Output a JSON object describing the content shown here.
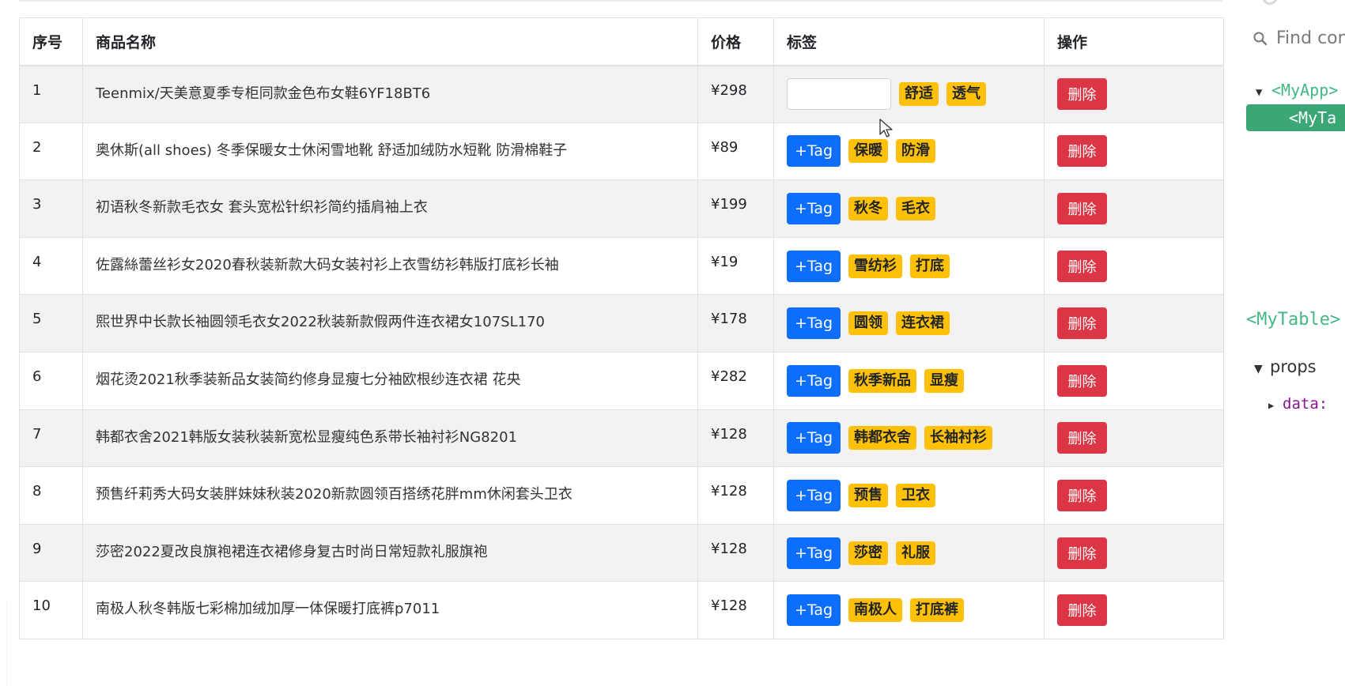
{
  "table": {
    "headers": {
      "index": "序号",
      "name": "商品名称",
      "price": "价格",
      "tags": "标签",
      "actions": "操作"
    },
    "add_tag_label": "+Tag",
    "delete_label": "删除",
    "rows": [
      {
        "id": "1",
        "name": "Teenmix/天美意夏季专柜同款金色布女鞋6YF18BT6",
        "price": "¥298",
        "tags": [
          "舒适",
          "透气"
        ],
        "input_visible": true
      },
      {
        "id": "2",
        "name": "奥休斯(all shoes) 冬季保暖女士休闲雪地靴 舒适加绒防水短靴 防滑棉鞋子",
        "price": "¥89",
        "tags": [
          "保暖",
          "防滑"
        ]
      },
      {
        "id": "3",
        "name": "初语秋冬新款毛衣女 套头宽松针织衫简约插肩袖上衣",
        "price": "¥199",
        "tags": [
          "秋冬",
          "毛衣"
        ]
      },
      {
        "id": "4",
        "name": "佐露絲蕾丝衫女2020春秋装新款大码女装衬衫上衣雪纺衫韩版打底衫长袖",
        "price": "¥19",
        "tags": [
          "雪纺衫",
          "打底"
        ]
      },
      {
        "id": "5",
        "name": "熙世界中长款长袖圆领毛衣女2022秋装新款假两件连衣裙女107SL170",
        "price": "¥178",
        "tags": [
          "圆领",
          "连衣裙"
        ]
      },
      {
        "id": "6",
        "name": "烟花烫2021秋季装新品女装简约修身显瘦七分袖欧根纱连衣裙 花央",
        "price": "¥282",
        "tags": [
          "秋季新品",
          "显瘦"
        ]
      },
      {
        "id": "7",
        "name": "韩都衣舍2021韩版女装秋装新宽松显瘦纯色系带长袖衬衫NG8201",
        "price": "¥128",
        "tags": [
          "韩都衣舍",
          "长袖衬衫"
        ]
      },
      {
        "id": "8",
        "name": "预售纤莉秀大码女装胖妹妹秋装2020新款圆领百搭绣花胖mm休闲套头卫衣",
        "price": "¥128",
        "tags": [
          "预售",
          "卫衣"
        ]
      },
      {
        "id": "9",
        "name": "莎密2022夏改良旗袍裙连衣裙修身复古时尚日常短款礼服旗袍",
        "price": "¥128",
        "tags": [
          "莎密",
          "礼服"
        ]
      },
      {
        "id": "10",
        "name": "南极人秋冬韩版七彩棉加绒加厚一体保暖打底裤p7011",
        "price": "¥128",
        "tags": [
          "南极人",
          "打底裤"
        ]
      }
    ]
  },
  "devtools": {
    "search_placeholder": "Find com",
    "tree_root": "<MyApp>",
    "tree_selected": "<MyTa",
    "component_title": "<MyTable>",
    "props_label": "props",
    "data_key": "data:"
  },
  "colors": {
    "primary": "#0d6efd",
    "danger": "#dc3545",
    "warning": "#ffc107",
    "vue_green": "#42b883"
  }
}
